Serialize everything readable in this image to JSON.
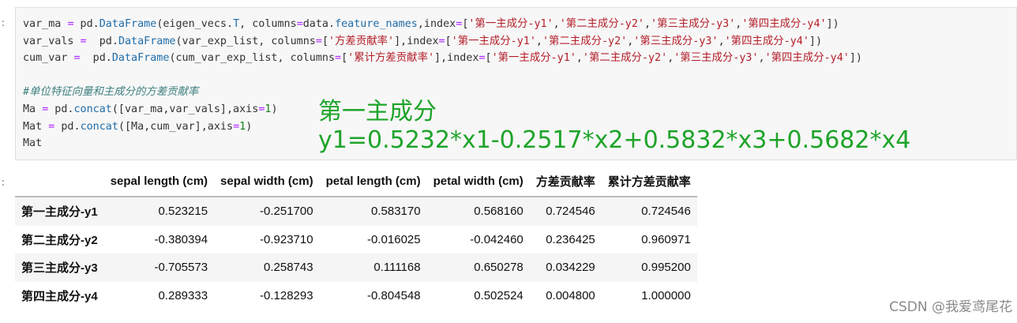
{
  "code": {
    "line1": [
      {
        "c": "",
        "t": "var_ma "
      },
      {
        "c": "op",
        "t": "="
      },
      {
        "c": "",
        "t": " pd."
      },
      {
        "c": "fn",
        "t": "DataFrame"
      },
      {
        "c": "",
        "t": "(eigen_vecs."
      },
      {
        "c": "fn",
        "t": "T"
      },
      {
        "c": "",
        "t": ", columns"
      },
      {
        "c": "op",
        "t": "="
      },
      {
        "c": "",
        "t": "data."
      },
      {
        "c": "fn",
        "t": "feature_names"
      },
      {
        "c": "",
        "t": ",index"
      },
      {
        "c": "op",
        "t": "="
      },
      {
        "c": "",
        "t": "["
      },
      {
        "c": "str",
        "t": "'第一主成分-y1'"
      },
      {
        "c": "",
        "t": ","
      },
      {
        "c": "str",
        "t": "'第二主成分-y2'"
      },
      {
        "c": "",
        "t": ","
      },
      {
        "c": "str",
        "t": "'第三主成分-y3'"
      },
      {
        "c": "",
        "t": ","
      },
      {
        "c": "str",
        "t": "'第四主成分-y4'"
      },
      {
        "c": "",
        "t": "])"
      }
    ],
    "line2": [
      {
        "c": "",
        "t": "var_vals "
      },
      {
        "c": "op",
        "t": "="
      },
      {
        "c": "",
        "t": "  pd."
      },
      {
        "c": "fn",
        "t": "DataFrame"
      },
      {
        "c": "",
        "t": "(var_exp_list, columns"
      },
      {
        "c": "op",
        "t": "="
      },
      {
        "c": "",
        "t": "["
      },
      {
        "c": "str",
        "t": "'方差贡献率'"
      },
      {
        "c": "",
        "t": "],index"
      },
      {
        "c": "op",
        "t": "="
      },
      {
        "c": "",
        "t": "["
      },
      {
        "c": "str",
        "t": "'第一主成分-y1'"
      },
      {
        "c": "",
        "t": ","
      },
      {
        "c": "str",
        "t": "'第二主成分-y2'"
      },
      {
        "c": "",
        "t": ","
      },
      {
        "c": "str",
        "t": "'第三主成分-y3'"
      },
      {
        "c": "",
        "t": ","
      },
      {
        "c": "str",
        "t": "'第四主成分-y4'"
      },
      {
        "c": "",
        "t": "])"
      }
    ],
    "line3": [
      {
        "c": "",
        "t": "cum_var "
      },
      {
        "c": "op",
        "t": "="
      },
      {
        "c": "",
        "t": "  pd."
      },
      {
        "c": "fn",
        "t": "DataFrame"
      },
      {
        "c": "",
        "t": "(cum_var_exp_list, columns"
      },
      {
        "c": "op",
        "t": "="
      },
      {
        "c": "",
        "t": "["
      },
      {
        "c": "str",
        "t": "'累计方差贡献率'"
      },
      {
        "c": "",
        "t": "],index"
      },
      {
        "c": "op",
        "t": "="
      },
      {
        "c": "",
        "t": "["
      },
      {
        "c": "str",
        "t": "'第一主成分-y1'"
      },
      {
        "c": "",
        "t": ","
      },
      {
        "c": "str",
        "t": "'第二主成分-y2'"
      },
      {
        "c": "",
        "t": ","
      },
      {
        "c": "str",
        "t": "'第三主成分-y3'"
      },
      {
        "c": "",
        "t": ","
      },
      {
        "c": "str",
        "t": "'第四主成分-y4'"
      },
      {
        "c": "",
        "t": "])"
      }
    ],
    "line4": [],
    "line5": [
      {
        "c": "cm",
        "t": "#单位特征向量和主成分的方差贡献率"
      }
    ],
    "line6": [
      {
        "c": "",
        "t": "Ma "
      },
      {
        "c": "op",
        "t": "="
      },
      {
        "c": "",
        "t": " pd."
      },
      {
        "c": "fn",
        "t": "concat"
      },
      {
        "c": "",
        "t": "([var_ma,var_vals],axis"
      },
      {
        "c": "op",
        "t": "="
      },
      {
        "c": "num",
        "t": "1"
      },
      {
        "c": "",
        "t": ")"
      }
    ],
    "line7": [
      {
        "c": "",
        "t": "Mat "
      },
      {
        "c": "op",
        "t": "="
      },
      {
        "c": "",
        "t": " pd."
      },
      {
        "c": "fn",
        "t": "concat"
      },
      {
        "c": "",
        "t": "([Ma,cum_var],axis"
      },
      {
        "c": "op",
        "t": "="
      },
      {
        "c": "num",
        "t": "1"
      },
      {
        "c": "",
        "t": ")"
      }
    ],
    "line8": [
      {
        "c": "",
        "t": "Mat"
      }
    ]
  },
  "overlay": {
    "title": "第一主成分",
    "formula": "y1=0.5232*x1-0.2517*x2+0.5832*x3+0.5682*x4",
    "color": "#1ea42a"
  },
  "prompts": {
    "input": ":",
    "output": ":"
  },
  "table": {
    "columns": [
      "",
      "sepal length (cm)",
      "sepal width (cm)",
      "petal length (cm)",
      "petal width (cm)",
      "方差贡献率",
      "累计方差贡献率"
    ],
    "rows": [
      {
        "index": "第一主成分-y1",
        "values": [
          "0.523215",
          "-0.251700",
          "0.583170",
          "0.568160",
          "0.724546",
          "0.724546"
        ]
      },
      {
        "index": "第二主成分-y2",
        "values": [
          "-0.380394",
          "-0.923710",
          "-0.016025",
          "-0.042460",
          "0.236425",
          "0.960971"
        ]
      },
      {
        "index": "第三主成分-y3",
        "values": [
          "-0.705573",
          "0.258743",
          "0.111168",
          "0.650278",
          "0.034229",
          "0.995200"
        ]
      },
      {
        "index": "第四主成分-y4",
        "values": [
          "0.289333",
          "-0.128293",
          "-0.804548",
          "0.502524",
          "0.004800",
          "1.000000"
        ]
      }
    ]
  },
  "watermark": "CSDN @我爱鸢尾花"
}
